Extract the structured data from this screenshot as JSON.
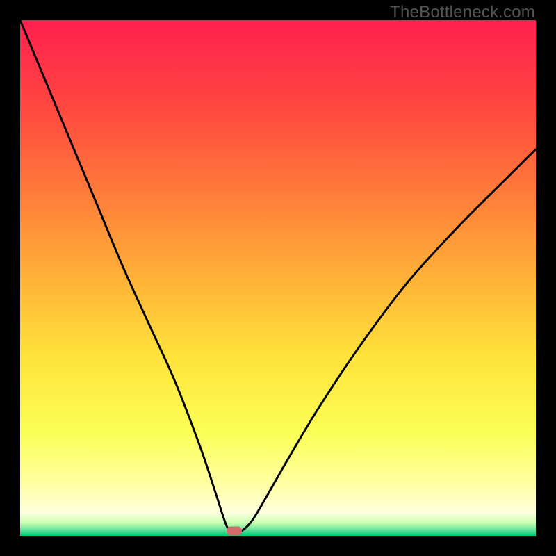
{
  "watermark": "TheBottleneck.com",
  "chart_data": {
    "type": "line",
    "title": "",
    "xlabel": "",
    "ylabel": "",
    "xlim": [
      0,
      100
    ],
    "ylim": [
      0,
      100
    ],
    "grid": false,
    "gradient_stops": [
      {
        "pos": 0.0,
        "color": "#ff1f4f"
      },
      {
        "pos": 0.18,
        "color": "#ff4a3f"
      },
      {
        "pos": 0.33,
        "color": "#ff7a3a"
      },
      {
        "pos": 0.5,
        "color": "#ffb138"
      },
      {
        "pos": 0.65,
        "color": "#ffe23a"
      },
      {
        "pos": 0.8,
        "color": "#fbff55"
      },
      {
        "pos": 0.905,
        "color": "#ffffa8"
      },
      {
        "pos": 0.955,
        "color": "#ffffe0"
      },
      {
        "pos": 0.975,
        "color": "#c8ffb0"
      },
      {
        "pos": 0.99,
        "color": "#55e097"
      },
      {
        "pos": 1.0,
        "color": "#00c876"
      }
    ],
    "series": [
      {
        "name": "bottleneck-curve",
        "color": "#000000",
        "x": [
          0,
          5,
          10,
          15,
          20,
          25,
          30,
          35,
          38,
          40,
          41,
          42,
          43,
          45,
          48,
          52,
          58,
          66,
          75,
          85,
          95,
          100
        ],
        "y": [
          100,
          88,
          76,
          64,
          52,
          41,
          30,
          17,
          8,
          2,
          1,
          1,
          1,
          3,
          8,
          15,
          25,
          37,
          49,
          60,
          70,
          75
        ]
      }
    ],
    "marker": {
      "x": 41.5,
      "y": 1,
      "color": "#d46a6a"
    }
  }
}
